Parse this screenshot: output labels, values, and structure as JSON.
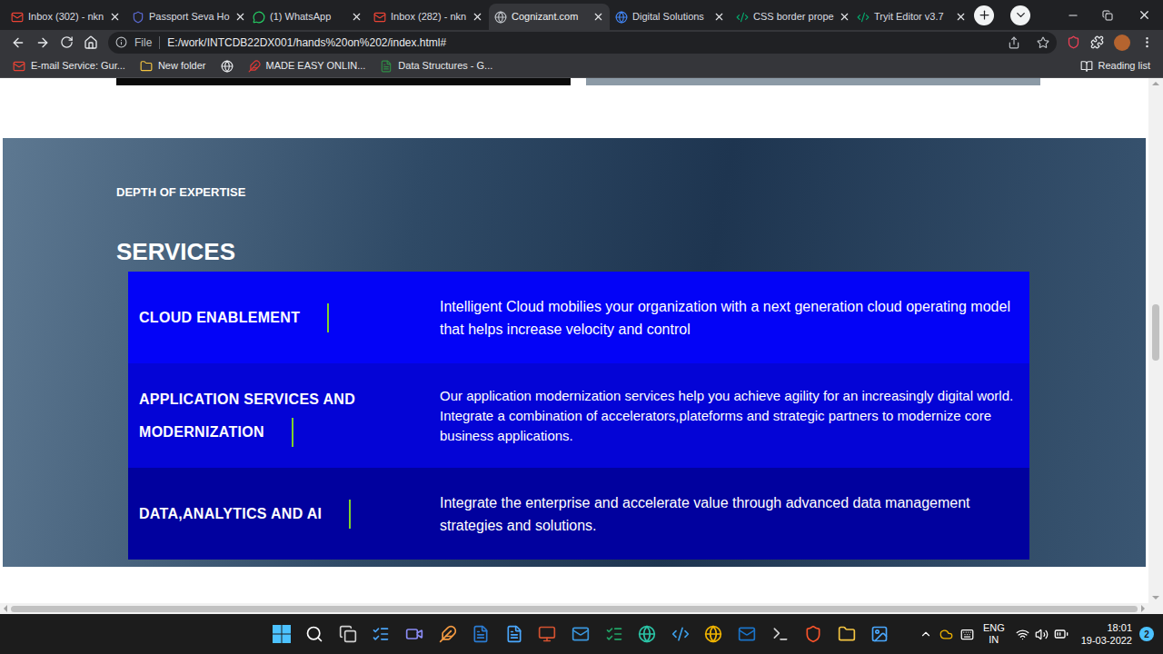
{
  "browser": {
    "tabs": [
      {
        "label": "Inbox (302) - nkn",
        "selected": false
      },
      {
        "label": "Passport Seva Ho",
        "selected": false
      },
      {
        "label": "(1) WhatsApp",
        "selected": false
      },
      {
        "label": "Inbox (282) - nkn",
        "selected": false
      },
      {
        "label": "Cognizant.com",
        "selected": true
      },
      {
        "label": "Digital Solutions",
        "selected": false
      },
      {
        "label": "CSS border prope",
        "selected": false
      },
      {
        "label": "Tryit Editor v3.7",
        "selected": false
      }
    ],
    "address": {
      "scheme": "File",
      "url": "E:/work/INTCDB22DX001/hands%20on%202/index.html#"
    },
    "bookmarks": [
      "E-mail Service: Gur...",
      "New folder",
      "MADE EASY ONLIN...",
      "Data Structures - G..."
    ],
    "reading_list": "Reading list"
  },
  "page": {
    "eyebrow": "DEPTH OF EXPERTISE",
    "heading": "SERVICES",
    "services": [
      {
        "title": "CLOUD ENABLEMENT",
        "description": "Intelligent Cloud mobilies your organization with a next generation cloud operating model that helps increase velocity and control",
        "color": "#0303f7"
      },
      {
        "title": "APPLICATION SERVICES AND MODERNIZATION",
        "description": "Our application modernization services help you achieve agility for an increasingly digital world. Integrate a combination of accelerators,plateforms and strategic partners to modernize core business applications.",
        "color": "#0404d6"
      },
      {
        "title": "DATA,ANALYTICS AND AI",
        "description": "Integrate the enterprise and accelerate value through advanced data management strategies and solutions.",
        "color": "#01019e"
      }
    ]
  },
  "taskbar": {
    "language": "ENG",
    "region": "IN",
    "time": "18:01",
    "date": "19-03-2022",
    "notifications": "2"
  }
}
